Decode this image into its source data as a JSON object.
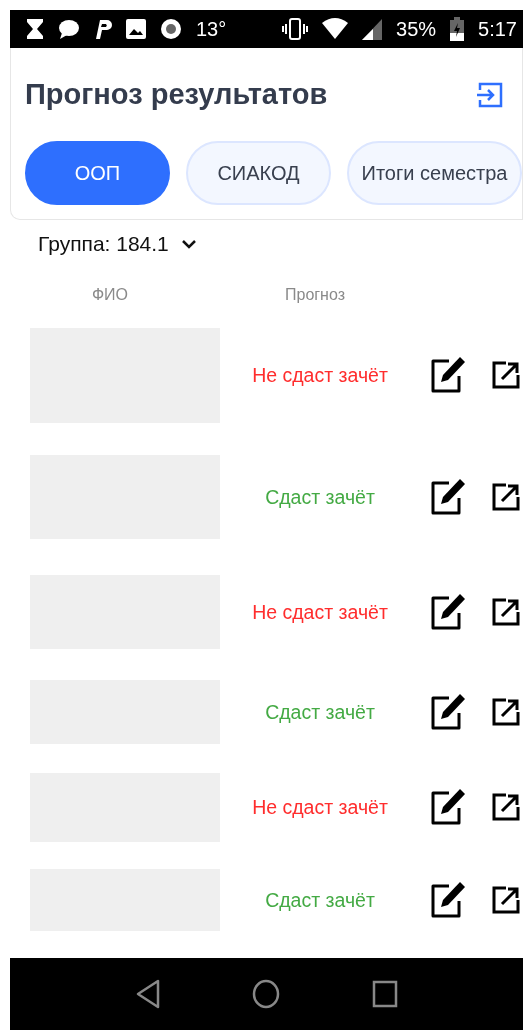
{
  "status_bar": {
    "temperature": "13°",
    "battery": "35%",
    "time": "5:17"
  },
  "title": "Прогноз результатов",
  "tabs": [
    {
      "label": "ООП",
      "selected": true
    },
    {
      "label": "СИАКОД",
      "selected": false
    },
    {
      "label": "Итоги семестра",
      "selected": false
    }
  ],
  "group": "Группа: 184.1",
  "table": {
    "columns": [
      "ФИО",
      "Прогноз"
    ],
    "rows": [
      {
        "forecast": "Не сдаст зачёт",
        "passes": false
      },
      {
        "forecast": "Сдаст зачёт",
        "passes": true
      },
      {
        "forecast": "Не сдаст зачёт",
        "passes": false
      },
      {
        "forecast": "Сдаст зачёт",
        "passes": true
      },
      {
        "forecast": "Не сдаст зачёт",
        "passes": false
      },
      {
        "forecast": "Сдаст зачёт",
        "passes": true
      }
    ]
  }
}
